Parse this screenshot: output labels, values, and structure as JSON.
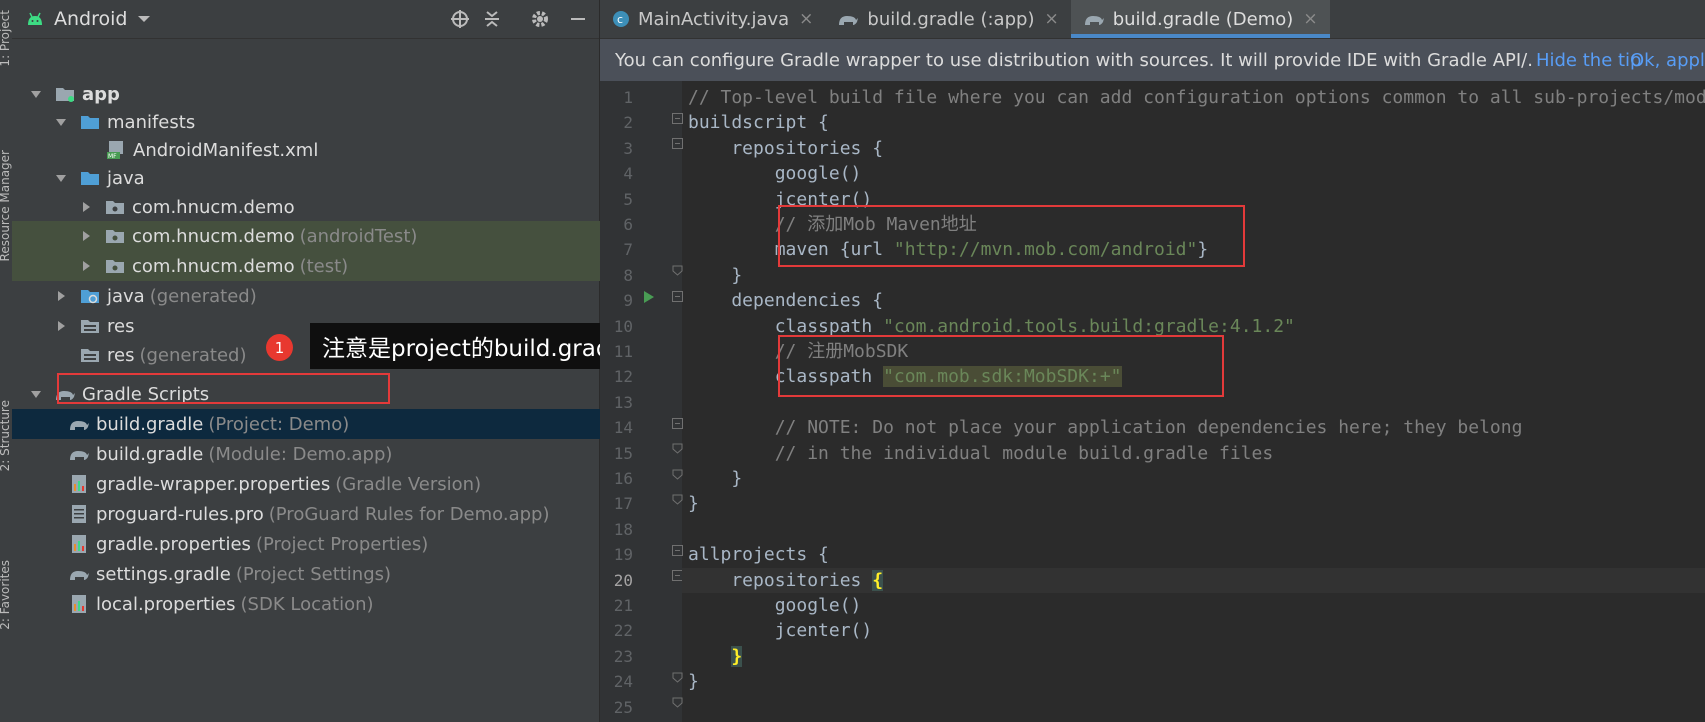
{
  "side_strip": {
    "labels": [
      "1: Project",
      "Resource Manager",
      "2: Structure",
      "2: Favorites"
    ]
  },
  "project_panel": {
    "view_selector": "Android",
    "tree": [
      {
        "label": "app",
        "dim": "",
        "bold": true
      },
      {
        "label": "manifests",
        "dim": ""
      },
      {
        "label": "AndroidManifest.xml",
        "dim": ""
      },
      {
        "label": "java",
        "dim": ""
      },
      {
        "label": "com.hnucm.demo",
        "dim": ""
      },
      {
        "label": "com.hnucm.demo",
        "dim": "(androidTest)"
      },
      {
        "label": "com.hnucm.demo",
        "dim": "(test)"
      },
      {
        "label": "java",
        "dim": "(generated)"
      },
      {
        "label": "res",
        "dim": ""
      },
      {
        "label": "res",
        "dim": "(generated)"
      },
      {
        "label": "Gradle Scripts",
        "dim": ""
      },
      {
        "label": "build.gradle",
        "dim": "(Project: Demo)"
      },
      {
        "label": "build.gradle",
        "dim": "(Module: Demo.app)"
      },
      {
        "label": "gradle-wrapper.properties",
        "dim": "(Gradle Version)"
      },
      {
        "label": "proguard-rules.pro",
        "dim": "(ProGuard Rules for Demo.app)"
      },
      {
        "label": "gradle.properties",
        "dim": "(Project Properties)"
      },
      {
        "label": "settings.gradle",
        "dim": "(Project Settings)"
      },
      {
        "label": "local.properties",
        "dim": "(SDK Location)"
      }
    ]
  },
  "annotation": {
    "badge": "1",
    "text": "注意是project的build.gradle"
  },
  "tabs": [
    {
      "label": "MainActivity.java",
      "close": "×"
    },
    {
      "label": "build.gradle (:app)",
      "close": "×"
    },
    {
      "label": "build.gradle (Demo)",
      "close": "×"
    }
  ],
  "notice": {
    "text": "You can configure Gradle wrapper to use distribution with sources. It will provide IDE with Gradle API/.",
    "hide_link": "Hide the tip",
    "ok_link": "Ok, apply"
  },
  "editor": {
    "current_line": 20,
    "line_numbers": [
      "1",
      "2",
      "3",
      "4",
      "5",
      "6",
      "7",
      "8",
      "9",
      "10",
      "11",
      "12",
      "13",
      "14",
      "15",
      "16",
      "17",
      "18",
      "19",
      "20",
      "21",
      "22",
      "23",
      "24",
      "25"
    ],
    "lines": {
      "l1": "// Top-level build file where you can add configuration options common to all sub-projects/modules.",
      "l2": "buildscript {",
      "l3": "    repositories {",
      "l4": "        google()",
      "l5": "        jcenter()",
      "l6": "        // 添加Mob Maven地址",
      "l7a": "        maven {url ",
      "l7b": "\"http://mvn.mob.com/android\"",
      "l7c": "}",
      "l8": "    }",
      "l9": "    dependencies {",
      "l10a": "        classpath ",
      "l10b": "\"com.android.tools.build:gradle:4.1.2\"",
      "l11": "        // 注册MobSDK",
      "l12a": "        classpath ",
      "l12b": "\"com.mob.sdk:MobSDK:+\"",
      "l14": "        // NOTE: Do not place your application dependencies here; they belong",
      "l15": "        // in the individual module build.gradle files",
      "l16": "    }",
      "l17": "}",
      "l19": "allprojects {",
      "l20a": "    repositories ",
      "l20b": "{",
      "l21": "        google()",
      "l22": "        jcenter()",
      "l23a": "    ",
      "l23b": "}",
      "l24": "}"
    }
  }
}
